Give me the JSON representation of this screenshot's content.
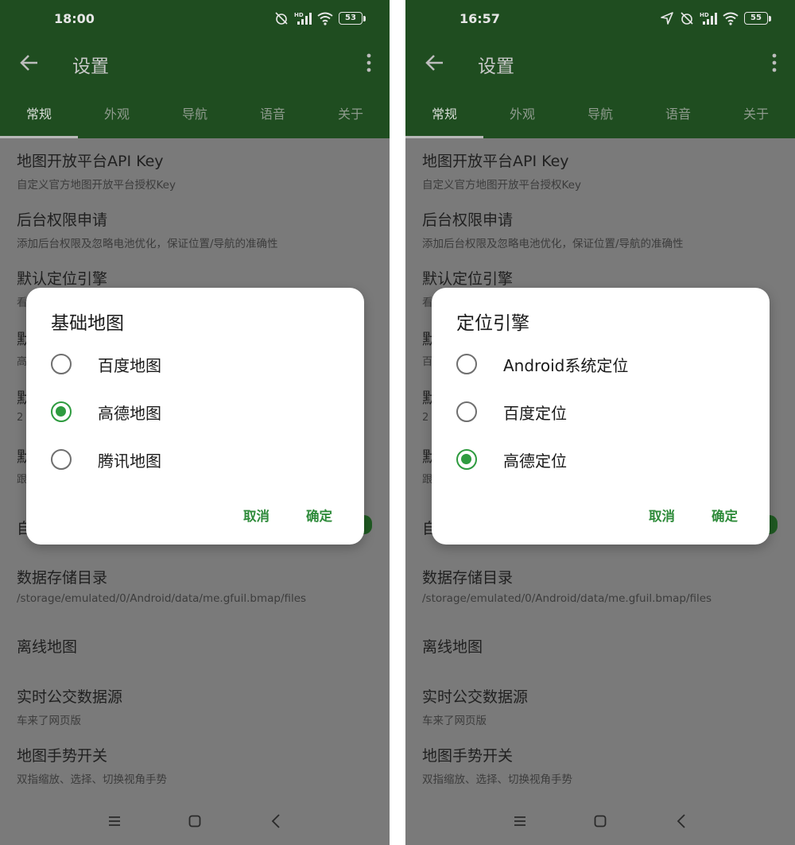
{
  "screens": [
    {
      "status_time": "18:00",
      "battery": "53",
      "title": "设置",
      "tabs": [
        "常规",
        "外观",
        "导航",
        "语音",
        "关于"
      ],
      "prefs": {
        "api_key_title": "地图开放平台API Key",
        "api_key_sub": "自定义官方地图开放平台授权Key",
        "bg_perm_title": "后台权限申请",
        "bg_perm_sub": "添加后台权限及忽略电池优化，保证位置/导航的准确性",
        "loc_engine_title": "默认定位引擎",
        "loc_engine_sub_partial": "看",
        "hidden1_title": "默",
        "hidden1_sub": "高",
        "hidden2_title": "默",
        "hidden2_sub": "2",
        "hidden3_title": "默",
        "hidden3_sub": "跟",
        "hidden4_title": "自",
        "storage_title": "数据存储目录",
        "storage_sub": "/storage/emulated/0/Android/data/me.gfuil.bmap/files",
        "offline_title": "离线地图",
        "bus_title": "实时公交数据源",
        "bus_sub": "车来了网页版",
        "gesture_title": "地图手势开关",
        "gesture_sub": "双指缩放、选择、切换视角手势"
      },
      "dialog": {
        "title": "基础地图",
        "options": [
          "百度地图",
          "高德地图",
          "腾讯地图"
        ],
        "selected_index": 1,
        "cancel": "取消",
        "ok": "确定"
      }
    },
    {
      "status_time": "16:57",
      "battery": "55",
      "title": "设置",
      "tabs": [
        "常规",
        "外观",
        "导航",
        "语音",
        "关于"
      ],
      "prefs": {
        "api_key_title": "地图开放平台API Key",
        "api_key_sub": "自定义官方地图开放平台授权Key",
        "bg_perm_title": "后台权限申请",
        "bg_perm_sub": "添加后台权限及忽略电池优化，保证位置/导航的准确性",
        "loc_engine_title": "默认定位引擎",
        "loc_engine_sub_partial": "看",
        "hidden1_title": "默",
        "hidden1_sub": "百",
        "hidden2_title": "默",
        "hidden2_sub": "2",
        "hidden3_title": "默",
        "hidden3_sub": "跟",
        "hidden4_title": "自",
        "storage_title": "数据存储目录",
        "storage_sub": "/storage/emulated/0/Android/data/me.gfuil.bmap/files",
        "offline_title": "离线地图",
        "bus_title": "实时公交数据源",
        "bus_sub": "车来了网页版",
        "gesture_title": "地图手势开关",
        "gesture_sub": "双指缩放、选择、切换视角手势"
      },
      "dialog": {
        "title": "定位引擎",
        "options": [
          "Android系统定位",
          "百度定位",
          "高德定位"
        ],
        "selected_index": 2,
        "cancel": "取消",
        "ok": "确定"
      }
    }
  ],
  "colors": {
    "toolbar": "#1f4d20",
    "accent": "#2e9b3f",
    "scrim_bg": "#7a7a7a"
  },
  "icons": [
    "back-arrow-icon",
    "more-vert-icon",
    "alarm-off-icon",
    "hd-signal-icon",
    "wifi-icon",
    "location-arrow-icon",
    "nav-menu-icon",
    "nav-home-icon",
    "nav-back-icon"
  ]
}
